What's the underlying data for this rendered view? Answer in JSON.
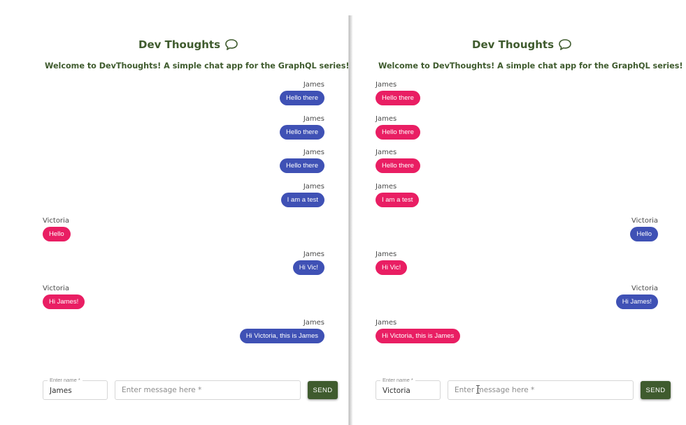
{
  "app": {
    "title": "Dev Thoughts",
    "title_icon": "speech-bubble-icon",
    "subtitle": "Welcome to DevThoughts! A simple chat app for the GraphQL series!"
  },
  "colors": {
    "title_green": "#3f5b2e",
    "blue_bubble": "#3f51b5",
    "pink_bubble": "#e91e63",
    "send_button": "#3f5b2e"
  },
  "left_pane": {
    "current_user": "James",
    "messages": [
      {
        "sender": "James",
        "text": "Hello there"
      },
      {
        "sender": "James",
        "text": "Hello there"
      },
      {
        "sender": "James",
        "text": "Hello there"
      },
      {
        "sender": "James",
        "text": "I am a test"
      },
      {
        "sender": "Victoria",
        "text": "Hello"
      },
      {
        "sender": "James",
        "text": "Hi Vic!"
      },
      {
        "sender": "Victoria",
        "text": "Hi James!"
      },
      {
        "sender": "James",
        "text": "Hi Victoria, this is James"
      }
    ],
    "name_field": {
      "label": "Enter name *",
      "value": "James"
    },
    "message_field": {
      "placeholder": "Enter message here *",
      "value": ""
    },
    "send_label": "SEND"
  },
  "right_pane": {
    "current_user": "Victoria",
    "messages": [
      {
        "sender": "James",
        "text": "Hello there"
      },
      {
        "sender": "James",
        "text": "Hello there"
      },
      {
        "sender": "James",
        "text": "Hello there"
      },
      {
        "sender": "James",
        "text": "I am a test"
      },
      {
        "sender": "Victoria",
        "text": "Hello"
      },
      {
        "sender": "James",
        "text": "Hi Vic!"
      },
      {
        "sender": "Victoria",
        "text": "Hi James!"
      },
      {
        "sender": "James",
        "text": "Hi Victoria, this is James"
      }
    ],
    "name_field": {
      "label": "Enter name *",
      "value": "Victoria"
    },
    "message_field": {
      "placeholder": "Enter message here *",
      "value": ""
    },
    "send_label": "SEND"
  }
}
